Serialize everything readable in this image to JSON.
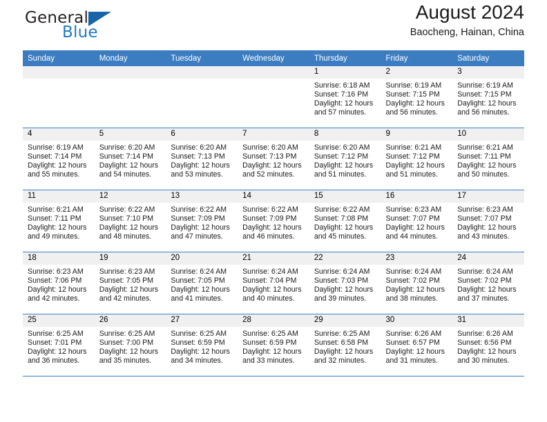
{
  "brand": {
    "line1": "General",
    "line2": "Blue",
    "triangle_color": "#1565a8",
    "blue_color": "#1f7ac4"
  },
  "header": {
    "title": "August 2024",
    "subtitle": "Baocheng, Hainan, China",
    "header_bg": "#3b7dc0",
    "daynum_bg": "#f0f0f0"
  },
  "weekdays": [
    "Sunday",
    "Monday",
    "Tuesday",
    "Wednesday",
    "Thursday",
    "Friday",
    "Saturday"
  ],
  "labels": {
    "sunrise": "Sunrise:",
    "sunset": "Sunset:",
    "daylight": "Daylight:"
  },
  "weeks": [
    [
      {
        "day": ""
      },
      {
        "day": ""
      },
      {
        "day": ""
      },
      {
        "day": ""
      },
      {
        "day": "1",
        "sunrise": "Sunrise: 6:18 AM",
        "sunset": "Sunset: 7:16 PM",
        "daylight": "Daylight: 12 hours and 57 minutes."
      },
      {
        "day": "2",
        "sunrise": "Sunrise: 6:19 AM",
        "sunset": "Sunset: 7:15 PM",
        "daylight": "Daylight: 12 hours and 56 minutes."
      },
      {
        "day": "3",
        "sunrise": "Sunrise: 6:19 AM",
        "sunset": "Sunset: 7:15 PM",
        "daylight": "Daylight: 12 hours and 56 minutes."
      }
    ],
    [
      {
        "day": "4",
        "sunrise": "Sunrise: 6:19 AM",
        "sunset": "Sunset: 7:14 PM",
        "daylight": "Daylight: 12 hours and 55 minutes."
      },
      {
        "day": "5",
        "sunrise": "Sunrise: 6:20 AM",
        "sunset": "Sunset: 7:14 PM",
        "daylight": "Daylight: 12 hours and 54 minutes."
      },
      {
        "day": "6",
        "sunrise": "Sunrise: 6:20 AM",
        "sunset": "Sunset: 7:13 PM",
        "daylight": "Daylight: 12 hours and 53 minutes."
      },
      {
        "day": "7",
        "sunrise": "Sunrise: 6:20 AM",
        "sunset": "Sunset: 7:13 PM",
        "daylight": "Daylight: 12 hours and 52 minutes."
      },
      {
        "day": "8",
        "sunrise": "Sunrise: 6:20 AM",
        "sunset": "Sunset: 7:12 PM",
        "daylight": "Daylight: 12 hours and 51 minutes."
      },
      {
        "day": "9",
        "sunrise": "Sunrise: 6:21 AM",
        "sunset": "Sunset: 7:12 PM",
        "daylight": "Daylight: 12 hours and 51 minutes."
      },
      {
        "day": "10",
        "sunrise": "Sunrise: 6:21 AM",
        "sunset": "Sunset: 7:11 PM",
        "daylight": "Daylight: 12 hours and 50 minutes."
      }
    ],
    [
      {
        "day": "11",
        "sunrise": "Sunrise: 6:21 AM",
        "sunset": "Sunset: 7:11 PM",
        "daylight": "Daylight: 12 hours and 49 minutes."
      },
      {
        "day": "12",
        "sunrise": "Sunrise: 6:22 AM",
        "sunset": "Sunset: 7:10 PM",
        "daylight": "Daylight: 12 hours and 48 minutes."
      },
      {
        "day": "13",
        "sunrise": "Sunrise: 6:22 AM",
        "sunset": "Sunset: 7:09 PM",
        "daylight": "Daylight: 12 hours and 47 minutes."
      },
      {
        "day": "14",
        "sunrise": "Sunrise: 6:22 AM",
        "sunset": "Sunset: 7:09 PM",
        "daylight": "Daylight: 12 hours and 46 minutes."
      },
      {
        "day": "15",
        "sunrise": "Sunrise: 6:22 AM",
        "sunset": "Sunset: 7:08 PM",
        "daylight": "Daylight: 12 hours and 45 minutes."
      },
      {
        "day": "16",
        "sunrise": "Sunrise: 6:23 AM",
        "sunset": "Sunset: 7:07 PM",
        "daylight": "Daylight: 12 hours and 44 minutes."
      },
      {
        "day": "17",
        "sunrise": "Sunrise: 6:23 AM",
        "sunset": "Sunset: 7:07 PM",
        "daylight": "Daylight: 12 hours and 43 minutes."
      }
    ],
    [
      {
        "day": "18",
        "sunrise": "Sunrise: 6:23 AM",
        "sunset": "Sunset: 7:06 PM",
        "daylight": "Daylight: 12 hours and 42 minutes."
      },
      {
        "day": "19",
        "sunrise": "Sunrise: 6:23 AM",
        "sunset": "Sunset: 7:05 PM",
        "daylight": "Daylight: 12 hours and 42 minutes."
      },
      {
        "day": "20",
        "sunrise": "Sunrise: 6:24 AM",
        "sunset": "Sunset: 7:05 PM",
        "daylight": "Daylight: 12 hours and 41 minutes."
      },
      {
        "day": "21",
        "sunrise": "Sunrise: 6:24 AM",
        "sunset": "Sunset: 7:04 PM",
        "daylight": "Daylight: 12 hours and 40 minutes."
      },
      {
        "day": "22",
        "sunrise": "Sunrise: 6:24 AM",
        "sunset": "Sunset: 7:03 PM",
        "daylight": "Daylight: 12 hours and 39 minutes."
      },
      {
        "day": "23",
        "sunrise": "Sunrise: 6:24 AM",
        "sunset": "Sunset: 7:02 PM",
        "daylight": "Daylight: 12 hours and 38 minutes."
      },
      {
        "day": "24",
        "sunrise": "Sunrise: 6:24 AM",
        "sunset": "Sunset: 7:02 PM",
        "daylight": "Daylight: 12 hours and 37 minutes."
      }
    ],
    [
      {
        "day": "25",
        "sunrise": "Sunrise: 6:25 AM",
        "sunset": "Sunset: 7:01 PM",
        "daylight": "Daylight: 12 hours and 36 minutes."
      },
      {
        "day": "26",
        "sunrise": "Sunrise: 6:25 AM",
        "sunset": "Sunset: 7:00 PM",
        "daylight": "Daylight: 12 hours and 35 minutes."
      },
      {
        "day": "27",
        "sunrise": "Sunrise: 6:25 AM",
        "sunset": "Sunset: 6:59 PM",
        "daylight": "Daylight: 12 hours and 34 minutes."
      },
      {
        "day": "28",
        "sunrise": "Sunrise: 6:25 AM",
        "sunset": "Sunset: 6:59 PM",
        "daylight": "Daylight: 12 hours and 33 minutes."
      },
      {
        "day": "29",
        "sunrise": "Sunrise: 6:25 AM",
        "sunset": "Sunset: 6:58 PM",
        "daylight": "Daylight: 12 hours and 32 minutes."
      },
      {
        "day": "30",
        "sunrise": "Sunrise: 6:26 AM",
        "sunset": "Sunset: 6:57 PM",
        "daylight": "Daylight: 12 hours and 31 minutes."
      },
      {
        "day": "31",
        "sunrise": "Sunrise: 6:26 AM",
        "sunset": "Sunset: 6:56 PM",
        "daylight": "Daylight: 12 hours and 30 minutes."
      }
    ]
  ]
}
